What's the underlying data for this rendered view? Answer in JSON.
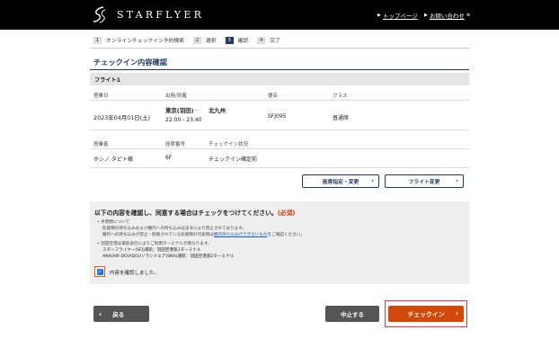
{
  "header": {
    "brand": "STARFLYER",
    "link_top": "トップページ",
    "link_contact": "お問い合わせ",
    "arrow": "▶",
    "contact_suffix": "⊕"
  },
  "steps": [
    {
      "num": "1",
      "label": "オンラインチェックイン予約検索"
    },
    {
      "num": "2",
      "label": "選択"
    },
    {
      "num": "3",
      "label": "確認"
    },
    {
      "num": "4",
      "label": "完了"
    }
  ],
  "page_title": "チェックイン内容確認",
  "flight_section": {
    "label": "フライト1",
    "headers": {
      "date": "搭乗日",
      "route": "出発/到着",
      "flight": "便名",
      "class": "クラス"
    },
    "row": {
      "date": "2023年04月01日(土)",
      "from": "東京(羽田)",
      "sep": "-",
      "to": "北九州",
      "times": "22:00 - 23:40",
      "flight": "SFJ095",
      "class": "普通席"
    }
  },
  "passenger_section": {
    "headers": {
      "name": "搭乗者",
      "seat": "座席番号",
      "status": "チェックイン状況"
    },
    "row": {
      "name": "ホシノ タピト様",
      "seat": "6F",
      "status": "チェックイン確定前"
    }
  },
  "buttons": {
    "seat_change": "座席指定・変更",
    "flight_change": "フライト変更",
    "back": "戻る",
    "cancel": "中止する",
    "checkin": "チェックイン"
  },
  "notice": {
    "title": "以下の内容を確認し、同意する場合はチェックをつけてください。",
    "required": "(必須)",
    "line1": "• 手荷物について",
    "line2": "危険物の持ち込みおよび機内への持ち込みは法令により禁止されております。",
    "line3_pre": "機内への持ち込みが禁止・制限されている危険物の代表例は",
    "line3_link": "機内持ち込みができないもの",
    "line3_post": "をご確認ください。",
    "line4": "• 羽田空港は運航会社によりご利用ターミナルが異なります。",
    "line5": "スターフライヤー(SFJ)運航：羽田空港第1ターミナル",
    "line6": "ANA/AIR DO(ADO)/ソラシドエア(SNA)運航：羽田空港第2ターミナル",
    "checkbox_label": "内容を確認しました。"
  },
  "colors": {
    "navy": "#1d3a5f",
    "orange": "#d14a0a",
    "required": "#d23c0a"
  }
}
